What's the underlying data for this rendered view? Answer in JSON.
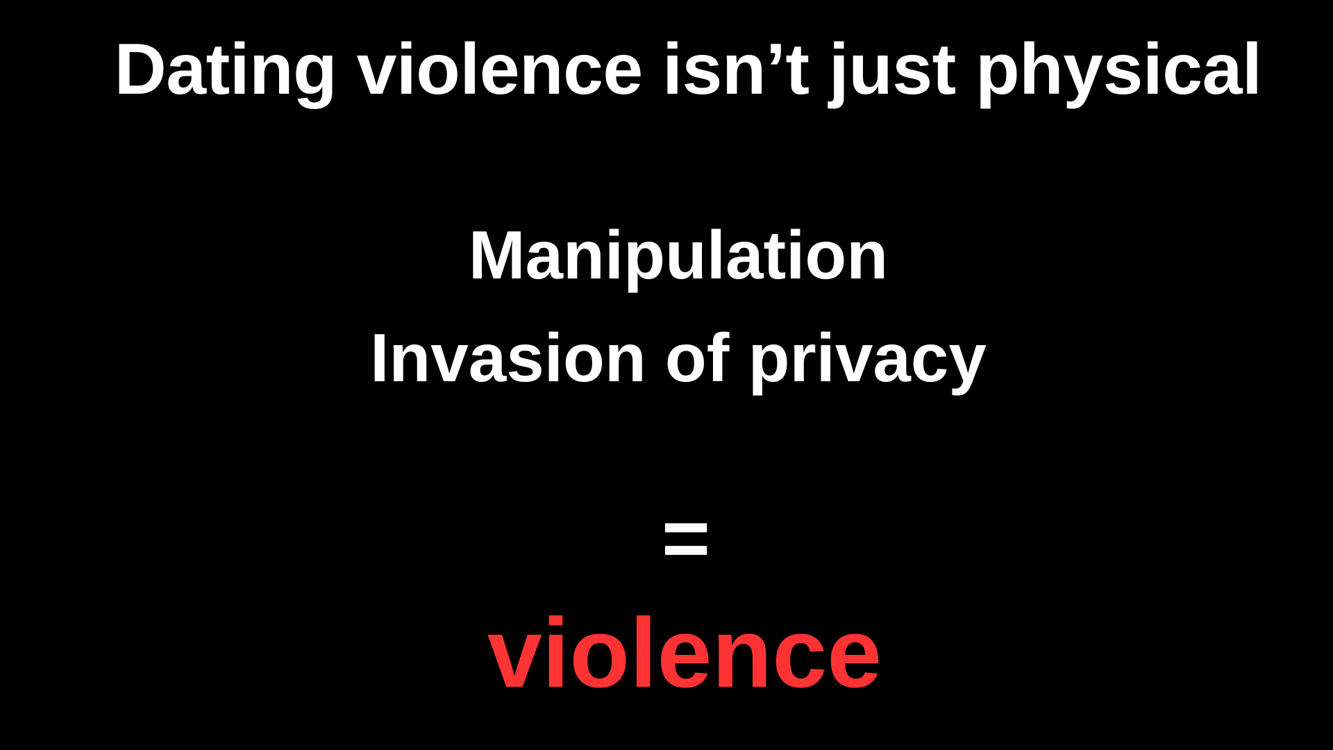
{
  "colors": {
    "background": "#000000",
    "text": "#ffffff",
    "accent": "#ff3333"
  },
  "slide": {
    "title": "Dating violence isn’t just physical",
    "items": [
      "Manipulation",
      "Invasion of privacy"
    ],
    "equals": "=",
    "result": "violence"
  }
}
